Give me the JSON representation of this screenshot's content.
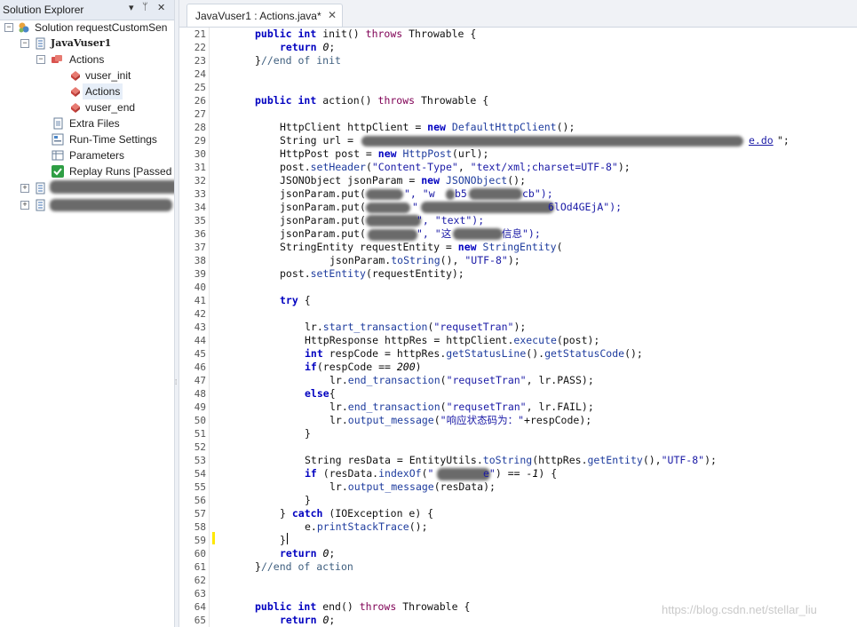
{
  "solution_explorer": {
    "title": "Solution Explorer",
    "header_icons": [
      "dropdown-icon",
      "pin-icon",
      "close-icon"
    ],
    "pin_glyph": "▾ ⊥",
    "close_glyph": "✕",
    "solution_label": "Solution requestCustomSen",
    "script_label": "JavaVuser1",
    "actions_folder": "Actions",
    "actions": [
      "vuser_init",
      "Actions",
      "vuser_end"
    ],
    "extra_files": "Extra Files",
    "runtime_settings": "Run-Time Settings",
    "parameters": "Parameters",
    "replay_runs": "Replay Runs [Passed"
  },
  "editor": {
    "tab_label": "JavaVuser1 : Actions.java*",
    "tab_close": "✕",
    "line_numbers": [
      "21",
      "22",
      "23",
      "24",
      "25",
      "26",
      "27",
      "28",
      "29",
      "30",
      "31",
      "32",
      "33",
      "34",
      "35",
      "36",
      "37",
      "38",
      "39",
      "40",
      "41",
      "42",
      "43",
      "44",
      "45",
      "46",
      "47",
      "48",
      "49",
      "50",
      "51",
      "52",
      "53",
      "54",
      "55",
      "56",
      "57",
      "58",
      "59",
      "60",
      "61",
      "62",
      "63",
      "64",
      "65"
    ],
    "code": {
      "l21": "public int init() throws Throwable {",
      "l22": "return 0;",
      "l23": "}//end of init",
      "l26": "public int action() throws Throwable {",
      "l28": "HttpClient httpClient = new DefaultHttpClient();",
      "l29a": "String url = ",
      "l29b": "e.do",
      "l29c": "\";",
      "l30": "HttpPost post = new HttpPost(url);",
      "l31": "post.setHeader(\"Content-Type\", \"text/xml;charset=UTF-8\");",
      "l32": "JSONObject jsonParam = new JSONObject();",
      "l33a": "jsonParam.put(",
      "l33b": "\", \"w",
      "l33c": "b5",
      "l33d": "cb\");",
      "l34a": "jsonParam.put(",
      "l34b": "\"",
      "l34c": "6lOd4GEjA\");",
      "l35a": "jsonParam.put(",
      "l35b": "\", \"text\");",
      "l36a": "jsonParam.put(",
      "l36b": "\", \"这",
      "l36c": "信息\");",
      "l37": "StringEntity requestEntity = new StringEntity(",
      "l38": "jsonParam.toString(), \"UTF-8\");",
      "l39": "post.setEntity(requestEntity);",
      "l41": "try {",
      "l43": "lr.start_transaction(\"requsetTran\");",
      "l44": "HttpResponse httpRes = httpClient.execute(post);",
      "l45": "int respCode = httpRes.getStatusLine().getStatusCode();",
      "l46": "if(respCode == 200)",
      "l47": "lr.end_transaction(\"requsetTran\", lr.PASS);",
      "l48": "else{",
      "l49": "lr.end_transaction(\"requsetTran\", lr.FAIL);",
      "l50": "lr.output_message(\"响应状态码为：\"+respCode);",
      "l51": "}",
      "l53": "String resData = EntityUtils.toString(httpRes.getEntity(),\"UTF-8\");",
      "l54a": "if (resData.indexOf(\"",
      "l54b": "e\") == -1) {",
      "l55": "lr.output_message(resData);",
      "l56": "}",
      "l57": "} catch (IOException e) {",
      "l58": "e.printStackTrace();",
      "l59": "}",
      "l60": "return 0;",
      "l61": "}//end of action",
      "l64": "public int end() throws Throwable {",
      "l65": "return 0;"
    }
  },
  "watermark": "https://blog.csdn.net/stellar_liu"
}
